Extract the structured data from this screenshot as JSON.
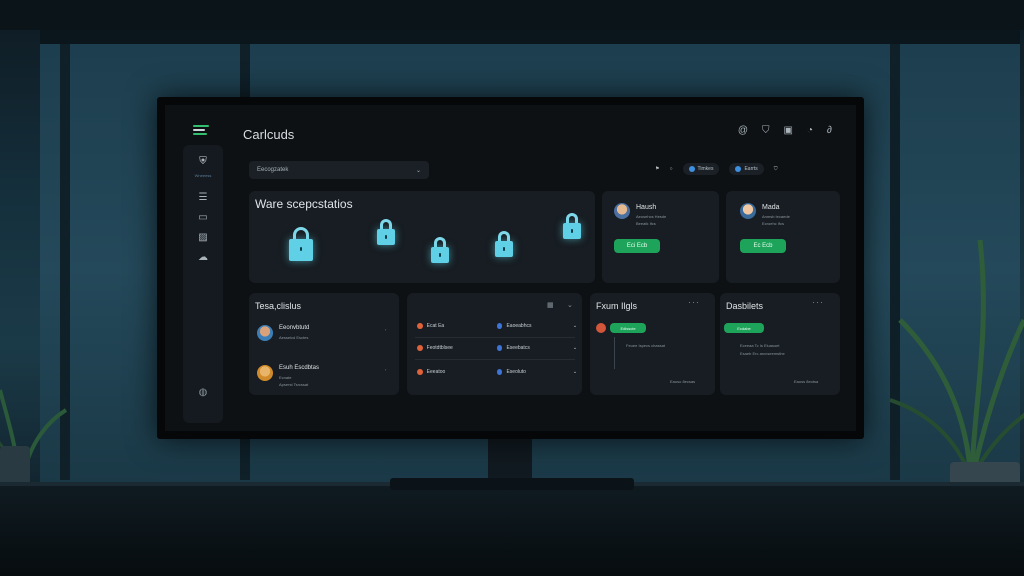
{
  "app": {
    "title": "Carlcuds"
  },
  "top_icons": [
    "at-icon",
    "shield-icon",
    "square-icon",
    "gauge-icon",
    "link-icon"
  ],
  "sidebar": {
    "items": [
      {
        "icon": "shield-lock-icon",
        "label": "Wneeess"
      },
      {
        "icon": "layers-icon"
      },
      {
        "icon": "folder-icon"
      },
      {
        "icon": "image-icon"
      },
      {
        "icon": "cloud-icon"
      }
    ],
    "bottom_icon": "globe-icon"
  },
  "search_select": {
    "value": "Eecogzatek"
  },
  "toolbar_right": {
    "icons": [
      "flag-icon",
      "circle-icon"
    ],
    "chip1": "Timkes",
    "chip2": "Earrts",
    "end_icon": "shield-check-icon"
  },
  "hero_card": {
    "title": "Ware scepcstatios"
  },
  "user_cards": [
    {
      "name": "Haush",
      "sub1": "Aeusehcs Hesde",
      "sub2": "Beeatk Ifcs",
      "button": "Eci Ecb"
    },
    {
      "name": "Mada",
      "sub1": "Anmsb Iecaede",
      "sub2": "Ecroehc Ifcs",
      "button": "Ec Ecb"
    }
  ],
  "team_card": {
    "title": "Tesa,clislus",
    "members": [
      {
        "name": "Eeonvbtutd",
        "sub": "Aesselcd Esctes"
      },
      {
        "name": "Esuh Escdbtas",
        "sub1": "Ecnate",
        "sub2": "Apserst Tsrcssat"
      }
    ]
  },
  "list_card": {
    "rows": [
      {
        "left": "Ecat Ea",
        "right": "Eaoeabhcs"
      },
      {
        "left": "Feotdtblsee",
        "right": "Eseebatcs"
      },
      {
        "left": "Eeeatoo",
        "right": "Eseoluto"
      }
    ]
  },
  "timeline_card": {
    "title": "Fxum Ilgls",
    "badge": "Edlsscte",
    "line": "Feuee Ispecs chassat",
    "footer": "Eauso 8ecsas"
  },
  "dashlets_card": {
    "title": "Dasbilets",
    "badge": "Ecdabe",
    "line1": "Eceeaa Tc Is  Eluasoet",
    "line2": "Esaeb Erc arcnseemsthe",
    "footer": "Eauss 8eotsa"
  },
  "colors": {
    "accent_green": "#1ea35a",
    "lock_cyan": "#5fd0e6",
    "screen_bg": "#0d1114"
  }
}
